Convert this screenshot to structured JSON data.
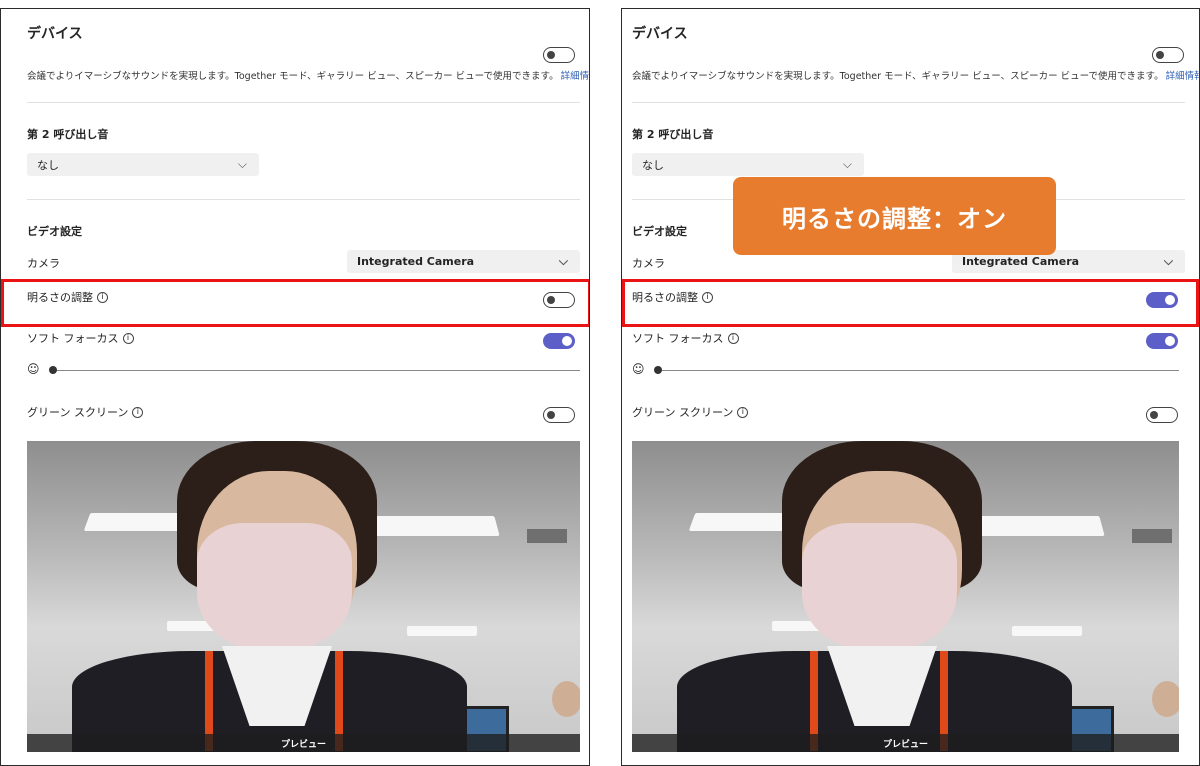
{
  "panels": [
    {
      "title": "デバイス",
      "description": "会議でよりイマーシブなサウンドを実現します。Together モード、ギャラリー ビュー、スピーカー ビューで使用できます。",
      "description_link": "詳細情報",
      "secondary_ringer_label": "第 2 呼び出し音",
      "secondary_ringer_value": "なし",
      "video_settings_label": "ビデオ設定",
      "camera_label": "カメラ",
      "camera_value": "Integrated Camera",
      "adjust_brightness_label": "明るさの調整",
      "adjust_brightness_on": false,
      "soft_focus_label": "ソフト フォーカス",
      "soft_focus_on": true,
      "soft_focus_level": 0,
      "green_screen_label": "グリーン スクリーン",
      "green_screen_on": false,
      "preview_label": "プレビュー"
    },
    {
      "title": "デバイス",
      "description": "会議でよりイマーシブなサウンドを実現します。Together モード、ギャラリー ビュー、スピーカー ビューで使用できます。",
      "description_link": "詳細情報",
      "secondary_ringer_label": "第 2 呼び出し音",
      "secondary_ringer_value": "なし",
      "video_settings_label": "ビデオ設定",
      "camera_label": "カメラ",
      "camera_value": "Integrated Camera",
      "adjust_brightness_label": "明るさの調整",
      "adjust_brightness_on": true,
      "soft_focus_label": "ソフト フォーカス",
      "soft_focus_on": true,
      "soft_focus_level": 0,
      "green_screen_label": "グリーン スクリーン",
      "green_screen_on": false,
      "preview_label": "プレビュー"
    }
  ],
  "callout": {
    "text": "明るさの調整：オン",
    "color": "#e77c2e"
  },
  "colors": {
    "toggle_on": "#5b5fc7",
    "highlight": "#ea1414",
    "link": "#2f5fb5"
  }
}
